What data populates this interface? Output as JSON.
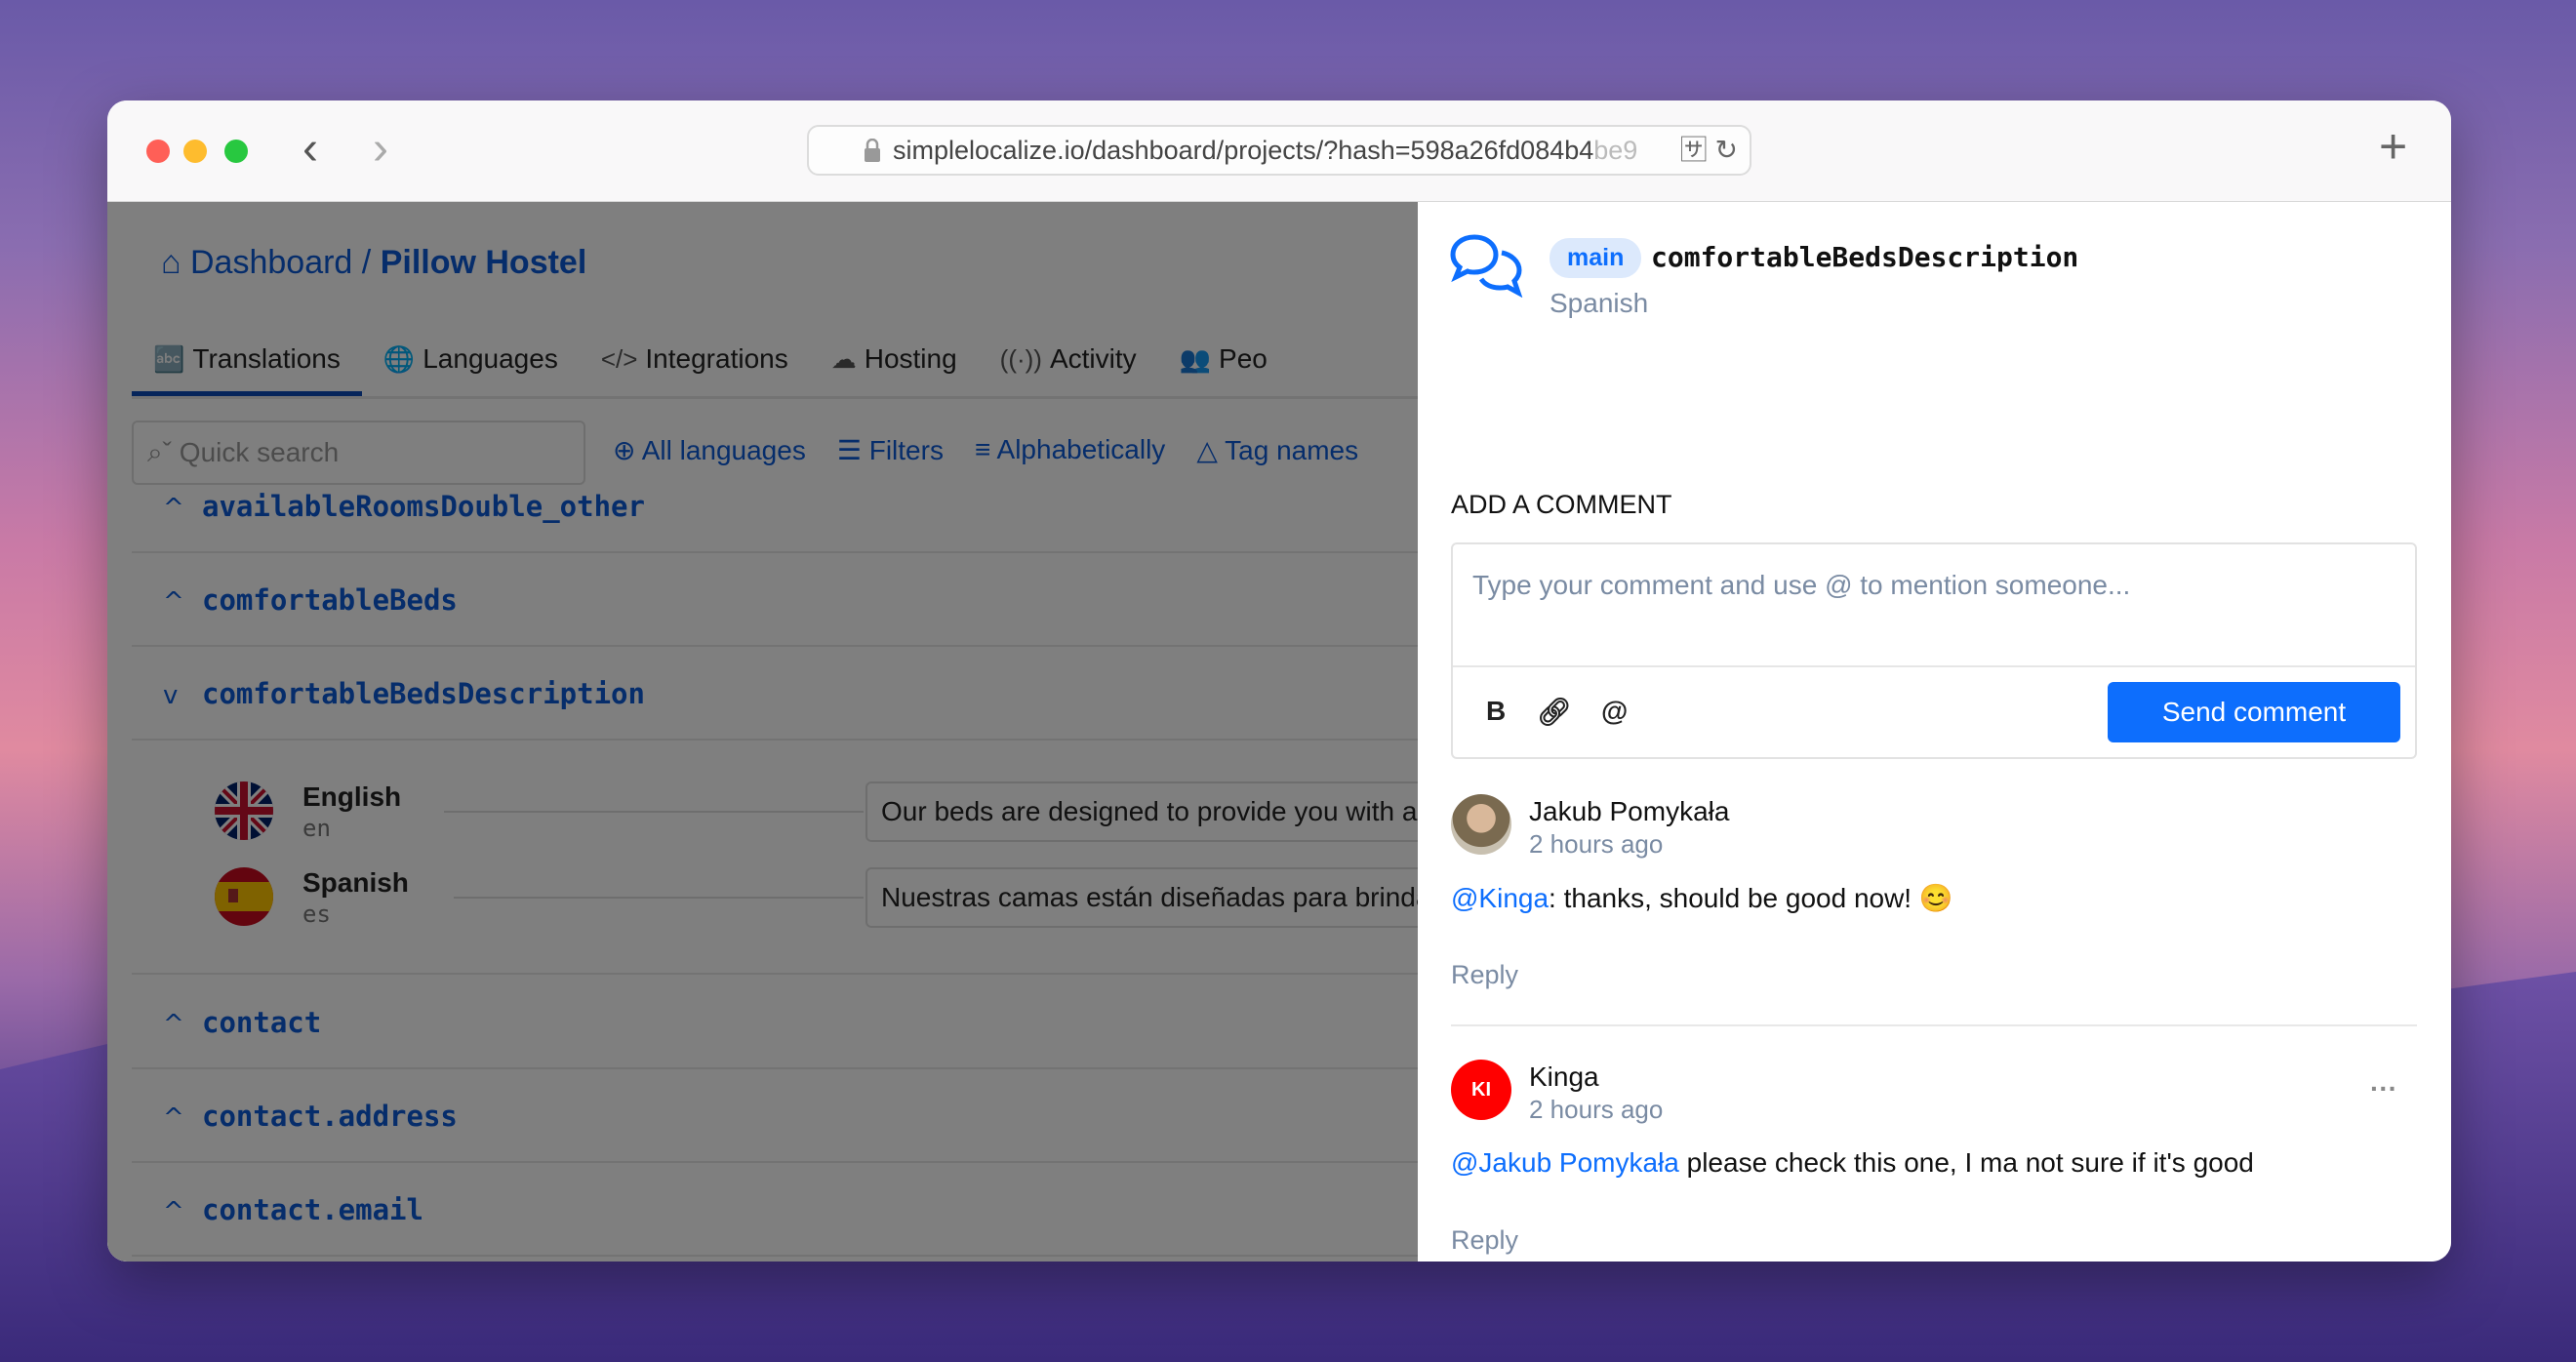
{
  "browser": {
    "url_main": "simplelocalize.io/dashboard/projects/?hash=598a26fd084b4",
    "url_fade": "be9",
    "colors": {
      "close": "#ff5f57",
      "minimize": "#febc2e",
      "maximize": "#28c840"
    }
  },
  "breadcrumb": {
    "root": "Dashboard",
    "separator": "/",
    "project": "Pillow Hostel"
  },
  "tabs": [
    {
      "label": "Translations",
      "icon": "az-icon"
    },
    {
      "label": "Languages",
      "icon": "globe-icon"
    },
    {
      "label": "Integrations",
      "icon": "code-icon"
    },
    {
      "label": "Hosting",
      "icon": "cloud-icon"
    },
    {
      "label": "Activity",
      "icon": "broadcast-icon"
    },
    {
      "label": "Peo",
      "icon": "people-icon"
    }
  ],
  "toolbar": {
    "search_placeholder": "Quick search",
    "all_languages": "All languages",
    "filters": "Filters",
    "sort": "Alphabetically",
    "tags": "Tag names"
  },
  "keys": [
    "availableRoomsDouble_other",
    "comfortableBeds",
    "comfortableBedsDescription",
    "contact",
    "contact.address",
    "contact.email"
  ],
  "translations": [
    {
      "language": "English",
      "code": "en",
      "value": "Our beds are designed to provide you with a good n"
    },
    {
      "language": "Spanish",
      "code": "es",
      "value": "Nuestras camas están diseñadas para brindarte una"
    }
  ],
  "panel": {
    "branch": "main",
    "key": "comfortableBedsDescription",
    "language": "Spanish",
    "heading": "ADD A COMMENT",
    "placeholder": "Type your comment and use @ to mention someone...",
    "bold": "B",
    "send": "Send comment",
    "accent": "#0d6efd"
  },
  "comments": [
    {
      "author": "Jakub Pomykała",
      "time": "2 hours ago",
      "mention": "@Kinga",
      "text": ": thanks, should be good now! 😊",
      "reply": "Reply"
    },
    {
      "author": "Kinga",
      "initials": "KI",
      "avatar_color": "#ff0000",
      "time": "2 hours ago",
      "mention": "@Jakub Pomykała",
      "text": " please check this one, I ma not sure if it's good",
      "reply": "Reply"
    }
  ]
}
